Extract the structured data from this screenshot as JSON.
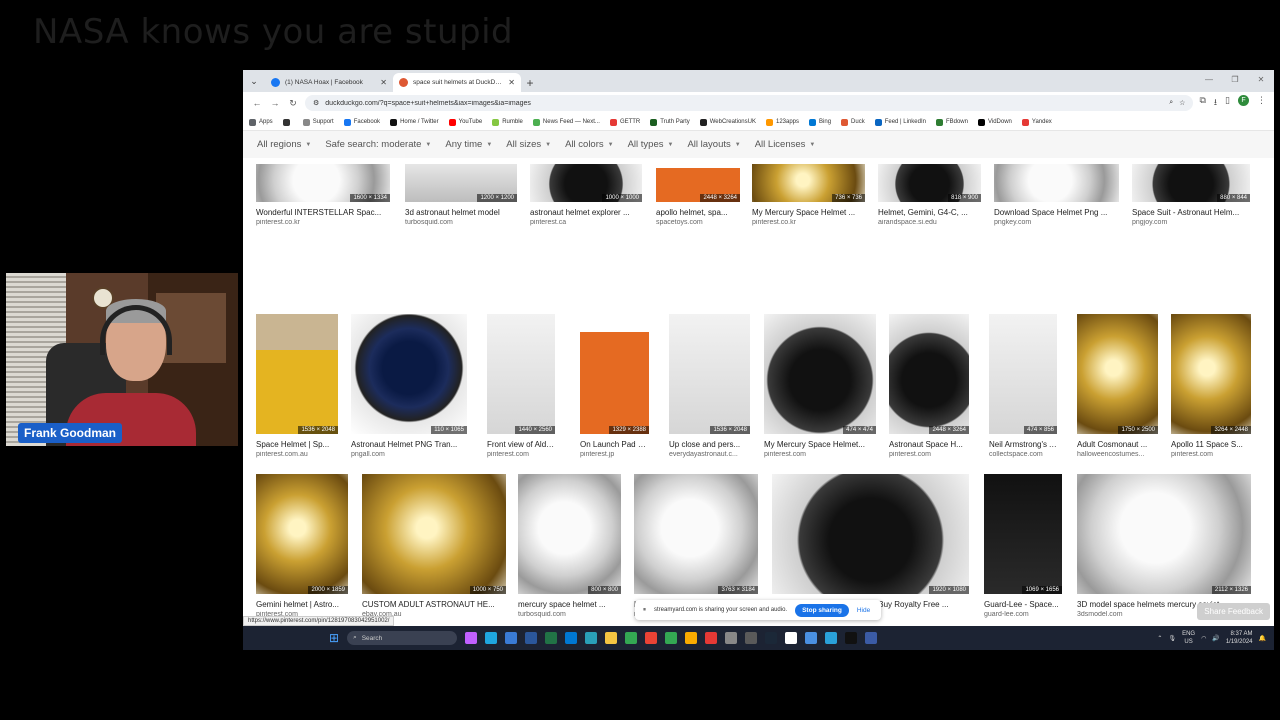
{
  "banner": "NASA knows you are stupid",
  "webcam": {
    "name": "Frank Goodman"
  },
  "browser": {
    "tabs": [
      {
        "title": "(1) NASA Hoax | Facebook",
        "favicon_color": "#1877f2",
        "active": false
      },
      {
        "title": "space suit helmets at DuckDuck",
        "favicon_color": "#de5833",
        "active": true
      }
    ],
    "url": "duckduckgo.com/?q=space+suit+helmets&iax=images&ia=images",
    "bookmarks": [
      {
        "label": "Apps",
        "color": "#5f6368"
      },
      {
        "label": "",
        "color": "#333333"
      },
      {
        "label": "Support",
        "color": "#888888"
      },
      {
        "label": "Facebook",
        "color": "#1877f2"
      },
      {
        "label": "Home / Twitter",
        "color": "#111111"
      },
      {
        "label": "YouTube",
        "color": "#ff0000"
      },
      {
        "label": "Rumble",
        "color": "#85c742"
      },
      {
        "label": "News Feed — Next...",
        "color": "#4caf50"
      },
      {
        "label": "GETTR",
        "color": "#e53935"
      },
      {
        "label": "Truth Party",
        "color": "#1b5e20"
      },
      {
        "label": "WebCreationsUK",
        "color": "#222222"
      },
      {
        "label": "123apps",
        "color": "#ff9800"
      },
      {
        "label": "Bing",
        "color": "#0078d4"
      },
      {
        "label": "Duck",
        "color": "#de5833"
      },
      {
        "label": "Feed | LinkedIn",
        "color": "#0a66c2"
      },
      {
        "label": "FBdown",
        "color": "#2e7d32"
      },
      {
        "label": "VidDown",
        "color": "#000000"
      },
      {
        "label": "Yandex",
        "color": "#e53935"
      }
    ],
    "filters": [
      "All regions",
      "Safe search: moderate",
      "Any time",
      "All sizes",
      "All colors",
      "All types",
      "All layouts",
      "All Licenses"
    ],
    "results": [
      {
        "title": "Wonderful INTERSTELLAR Spac...",
        "source": "pinterest.co.kr",
        "dim": "1600 × 1334",
        "art": "h-white"
      },
      {
        "title": "3d astronaut helmet model",
        "source": "turbosquid.com",
        "dim": "1200 × 1200",
        "art": "grey"
      },
      {
        "title": "astronaut helmet explorer ...",
        "source": "pinterest.ca",
        "dim": "1000 × 1000",
        "art": "h-dark"
      },
      {
        "title": "apollo helmet, spa...",
        "source": "spacetoys.com",
        "dim": "2448 × 3264",
        "art": "orange"
      },
      {
        "title": "My Mercury Space Helmet ...",
        "source": "pinterest.co.kr",
        "dim": "736 × 736",
        "art": "h-gold"
      },
      {
        "title": "Helmet, Gemini, G4-C, ...",
        "source": "airandspace.si.edu",
        "dim": "818 × 900",
        "art": "h-dark"
      },
      {
        "title": "Download Space Helmet Png ...",
        "source": "pngkey.com",
        "dim": "",
        "art": "h-white"
      },
      {
        "title": "Space Suit - Astronaut Helm...",
        "source": "pngjoy.com",
        "dim": "880 × 844",
        "art": "h-dark"
      },
      {
        "title": "Space Helmet | Sp...",
        "source": "pinterest.com.au",
        "dim": "1536 × 2048",
        "art": "yellow"
      },
      {
        "title": "Astronaut Helmet PNG Tran...",
        "source": "pngall.com",
        "dim": "110 × 1065",
        "art": "h-space"
      },
      {
        "title": "Front view of Aldri...",
        "source": "pinterest.com",
        "dim": "1440 × 2560",
        "art": "suit"
      },
      {
        "title": "On Launch Pad 39...",
        "source": "pinterest.jp",
        "dim": "1329 × 2388",
        "art": "orange"
      },
      {
        "title": "Up close and pers...",
        "source": "everydayastronaut.c...",
        "dim": "1536 × 2048",
        "art": "suit"
      },
      {
        "title": "My Mercury Space Helmet...",
        "source": "pinterest.com",
        "dim": "474 × 474",
        "art": "h-dark"
      },
      {
        "title": "Astronaut Space H...",
        "source": "pinterest.com",
        "dim": "2448 × 3264",
        "art": "h-dark"
      },
      {
        "title": "Neil Armstrong's A...",
        "source": "collectspace.com",
        "dim": "474 × 856",
        "art": "suit"
      },
      {
        "title": "Adult Cosmonaut ...",
        "source": "halloweencostumes...",
        "dim": "1750 × 2500",
        "art": "h-gold"
      },
      {
        "title": "Apollo 11 Space S...",
        "source": "pinterest.com",
        "dim": "3264 × 2448",
        "art": "h-gold"
      },
      {
        "title": "Gemini helmet | Astro...",
        "source": "pinterest.com",
        "dim": "2000 × 1859",
        "art": "h-gold"
      },
      {
        "title": "CUSTOM ADULT ASTRONAUT HE...",
        "source": "ebay.com.au",
        "dim": "1000 × 750",
        "art": "h-gold"
      },
      {
        "title": "mercury space helmet ...",
        "source": "turbosquid.com",
        "dim": "800 × 800",
        "art": "h-white"
      },
      {
        "title": "Lot Detail - Cosmonaut Helme...",
        "source": "natedsanders.com",
        "dim": "3763 × 3184",
        "art": "h-white"
      },
      {
        "title": "Orion Astronaut Suit Helmet - Buy Royalty Free ...",
        "source": "sketchfab.com",
        "dim": "1920 × 1080",
        "art": "h-dark"
      },
      {
        "title": "Guard-Lee - Space...",
        "source": "guard-lee.com",
        "dim": "1069 × 1656",
        "art": "dark-bg"
      },
      {
        "title": "3D model space helmets mercury soviet - ...",
        "source": "3dsmodel.com",
        "dim": "2112 × 1326",
        "art": "h-white"
      },
      {
        "title": "",
        "source": "",
        "dim": "",
        "art": "h-white"
      },
      {
        "title": "",
        "source": "",
        "dim": "",
        "art": "olive"
      },
      {
        "title": "",
        "source": "",
        "dim": "",
        "art": "h-dark"
      },
      {
        "title": "",
        "source": "",
        "dim": "",
        "art": "h-gold"
      },
      {
        "title": "",
        "source": "",
        "dim": "",
        "art": "h-white"
      },
      {
        "title": "",
        "source": "",
        "dim": "",
        "art": "h-white"
      },
      {
        "title": "",
        "source": "",
        "dim": "",
        "art": "h-white"
      },
      {
        "title": "",
        "source": "",
        "dim": "",
        "art": "h-gold"
      }
    ],
    "status_url": "https://www.pinterest.com/pin/128197083042951002/",
    "share_notice": "streamyard.com is sharing your screen and audio.",
    "stop_sharing": "Stop sharing",
    "hide": "Hide",
    "share_feedback": "Share Feedback"
  },
  "taskbar": {
    "search_placeholder": "Search",
    "lang_line1": "ENG",
    "lang_line2": "US",
    "time": "8:37 AM",
    "date": "1/19/2024",
    "icons": [
      {
        "name": "copilot-icon",
        "color": "#c060ff"
      },
      {
        "name": "edge-icon",
        "color": "#1fa6e0"
      },
      {
        "name": "mail-icon",
        "color": "#3a7bd5"
      },
      {
        "name": "word-icon",
        "color": "#2b579a"
      },
      {
        "name": "excel-icon",
        "color": "#217346"
      },
      {
        "name": "outlook-icon",
        "color": "#0078d4"
      },
      {
        "name": "globe-icon",
        "color": "#2aa0b8"
      },
      {
        "name": "folder-icon",
        "color": "#f4c542"
      },
      {
        "name": "sheet-icon",
        "color": "#34a853"
      },
      {
        "name": "chrome-icon",
        "color": "#ea4335"
      },
      {
        "name": "chrome-alt-icon",
        "color": "#34a853"
      },
      {
        "name": "chrome-canary-icon",
        "color": "#f9ab00"
      },
      {
        "name": "app-s-icon",
        "color": "#e53935"
      },
      {
        "name": "tools-icon",
        "color": "#888888"
      },
      {
        "name": "terminal-icon",
        "color": "#5a5a5a"
      },
      {
        "name": "steam-icon",
        "color": "#1b2838"
      },
      {
        "name": "block-icon",
        "color": "#ffffff"
      },
      {
        "name": "vpn-icon",
        "color": "#4a90e2"
      },
      {
        "name": "telegram-icon",
        "color": "#2aa1da"
      },
      {
        "name": "tiktok-icon",
        "color": "#111111"
      },
      {
        "name": "streamyard-icon",
        "color": "#3b5ba5"
      }
    ]
  }
}
